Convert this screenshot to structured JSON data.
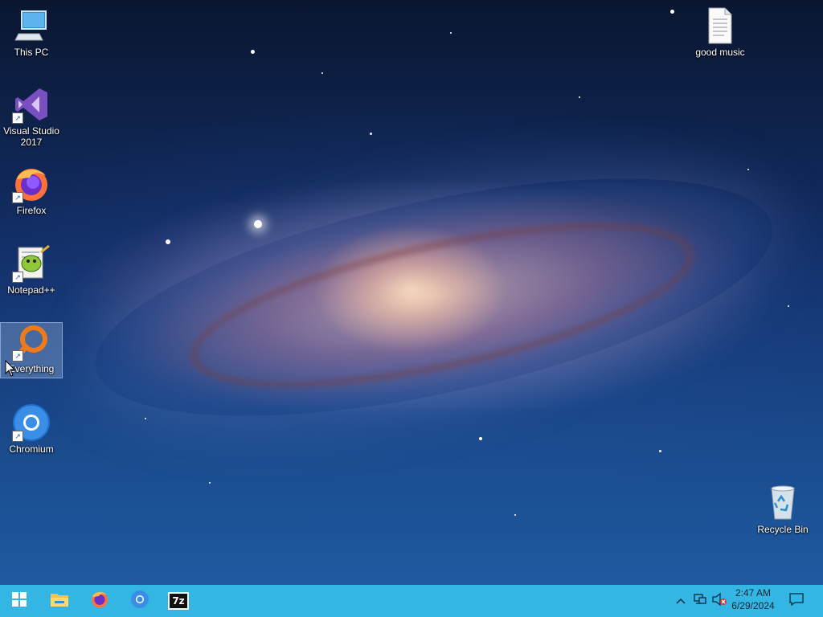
{
  "desktop": {
    "icons": [
      {
        "label": "This PC",
        "icon": "computer-icon"
      },
      {
        "label": "Visual Studio 2017",
        "icon": "visual-studio-icon",
        "shortcut": true
      },
      {
        "label": "Firefox",
        "icon": "firefox-icon",
        "shortcut": true
      },
      {
        "label": "Notepad++",
        "icon": "notepadpp-icon",
        "shortcut": true
      },
      {
        "label": "Everything",
        "icon": "everything-icon",
        "shortcut": true,
        "selected": true
      },
      {
        "label": "Chromium",
        "icon": "chromium-icon",
        "shortcut": true
      },
      {
        "label": "good music",
        "icon": "text-file-icon"
      },
      {
        "label": "Recycle Bin",
        "icon": "recycle-bin-icon"
      }
    ]
  },
  "taskbar": {
    "color": "#33b6e3",
    "pinned": [
      {
        "name": "start",
        "icon": "windows-logo-icon"
      },
      {
        "name": "file-explorer",
        "icon": "folder-icon"
      },
      {
        "name": "firefox",
        "icon": "firefox-icon"
      },
      {
        "name": "chromium",
        "icon": "chromium-icon"
      },
      {
        "name": "7-zip",
        "icon": "7zip-icon",
        "label": "7z"
      }
    ],
    "tray": {
      "time": "2:47 AM",
      "date": "6/29/2024"
    }
  }
}
